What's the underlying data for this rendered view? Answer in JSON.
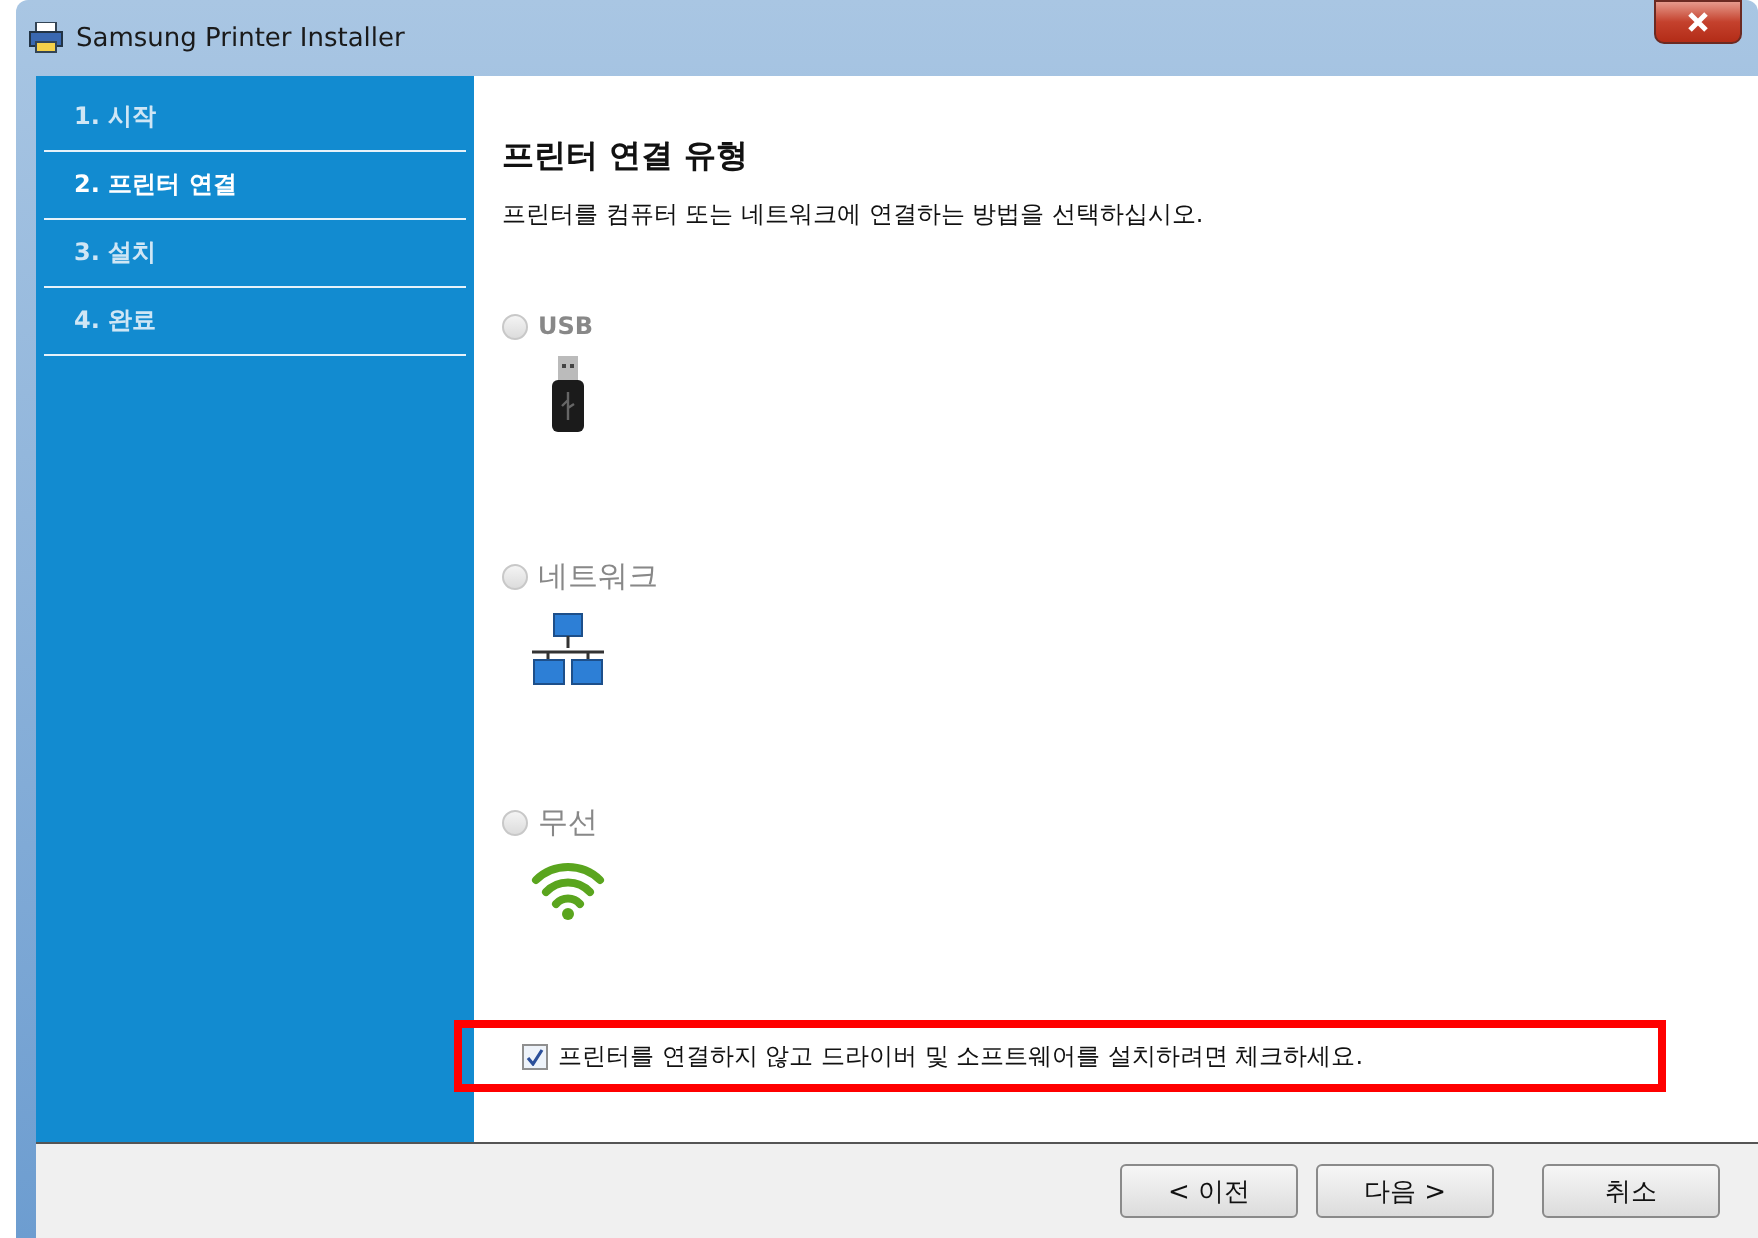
{
  "window": {
    "title": "Samsung Printer Installer"
  },
  "sidebar": {
    "items": [
      {
        "label": "1. 시작",
        "selected": false
      },
      {
        "label": "2. 프린터 연결",
        "selected": true
      },
      {
        "label": "3. 설치",
        "selected": false
      },
      {
        "label": "4. 완료",
        "selected": false
      }
    ]
  },
  "content": {
    "heading": "프린터 연결 유형",
    "description": "프린터를 컴퓨터 또는 네트워크에 연결하는 방법을 선택하십시오.",
    "options": [
      {
        "kind": "usb",
        "label": "USB",
        "selected": false,
        "disabled": true
      },
      {
        "kind": "network",
        "label": "네트워크",
        "selected": false,
        "disabled": true
      },
      {
        "kind": "wireless",
        "label": "무선",
        "selected": false,
        "disabled": true
      }
    ],
    "install_only": {
      "label": "프린터를 연결하지 않고 드라이버 및 소프트웨어를 설치하려면 체크하세요.",
      "checked": true,
      "highlighted": true
    }
  },
  "buttons": [
    "< 이전",
    "다음 >",
    "취소"
  ]
}
